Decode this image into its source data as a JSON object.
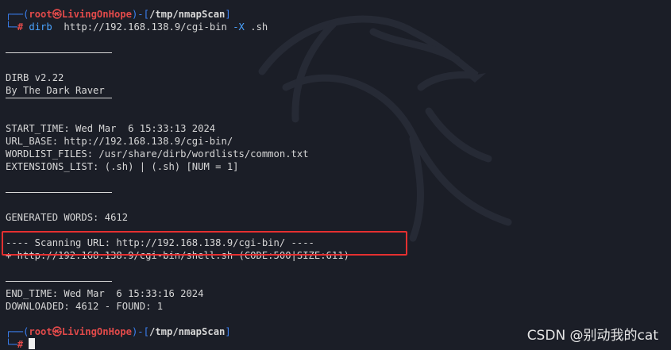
{
  "prompt1": {
    "top_left": "┌──(",
    "user": "root",
    "at_symbol": "㉿",
    "host": "LivingOnHope",
    "sep": ")-[",
    "cwd": "/tmp/nmapScan",
    "close": "]",
    "bottom_left": "└─",
    "hash": "#",
    "command": "dirb",
    "args_pre": "  http://192.168.138.9/cgi-bin ",
    "flag": "-X",
    "args_post": " .sh"
  },
  "output": {
    "title": "DIRB v2.22",
    "author": "By The Dark Raver",
    "start_time": "START_TIME: Wed Mar  6 15:33:13 2024",
    "url_base": "URL_BASE: http://192.168.138.9/cgi-bin/",
    "wordlist": "WORDLIST_FILES: /usr/share/dirb/wordlists/common.txt",
    "extensions": "EXTENSIONS_LIST: (.sh) | (.sh) [NUM = 1]",
    "generated": "GENERATED WORDS: 4612",
    "scanning": "---- Scanning URL: http://192.168.138.9/cgi-bin/ ----",
    "found": "+ http://192.168.138.9/cgi-bin/shell.sh (CODE:500|SIZE:611)",
    "end_time": "END_TIME: Wed Mar  6 15:33:16 2024",
    "downloaded": "DOWNLOADED: 4612 - FOUND: 1"
  },
  "prompt2": {
    "top_left": "┌──(",
    "user": "root",
    "at_symbol": "㉿",
    "host": "LivingOnHope",
    "sep": ")-[",
    "cwd": "/tmp/nmapScan",
    "close": "]",
    "bottom_left": "└─",
    "hash": "#"
  },
  "watermark": "CSDN @别动我的cat",
  "colors": {
    "background": "#1b1e27",
    "prompt_frame": "#3b82f6",
    "user_host": "#e14a4a",
    "highlight_box": "#e53030",
    "text": "#d7d7d7"
  }
}
